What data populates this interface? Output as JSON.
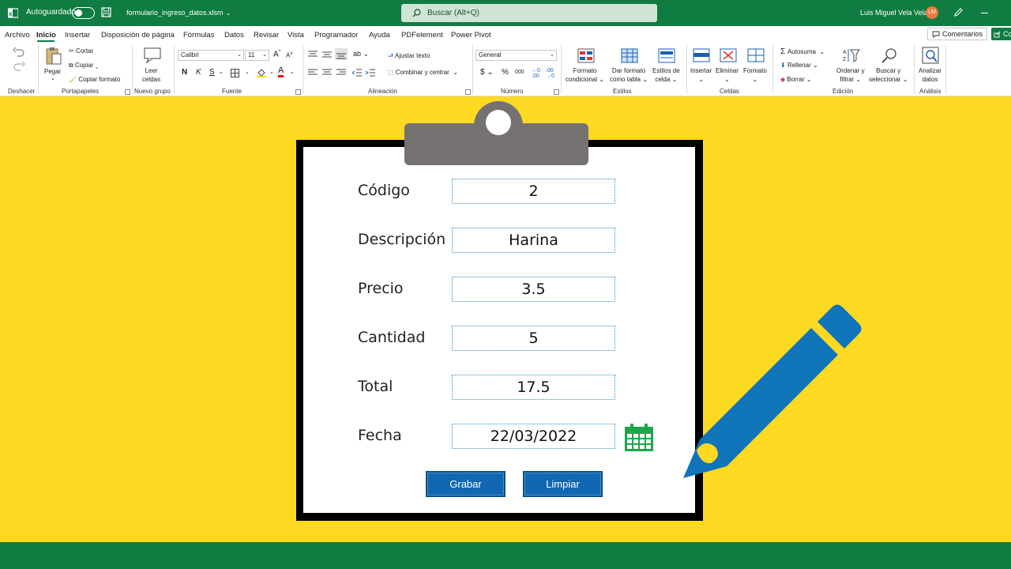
{
  "titlebar": {
    "autosave_label": "Autoguardado",
    "filename": "formulario_ingreso_datos.xlsm",
    "search_placeholder": "Buscar (Alt+Q)",
    "user_name": "Luis Miguel Vela Vela",
    "user_initials": "LM"
  },
  "menu": {
    "tabs": [
      "Archivo",
      "Inicio",
      "Insertar",
      "Disposición de página",
      "Fórmulas",
      "Datos",
      "Revisar",
      "Vista",
      "Programador",
      "Ayuda",
      "PDFelement",
      "Power Pivot"
    ],
    "active_tab": "Inicio",
    "comments_label": "Comentarios",
    "share_label": "Co"
  },
  "ribbon": {
    "undo_group": "Deshacer",
    "clipboard": {
      "paste": "Pegar",
      "cut": "Cortar",
      "copy": "Copiar",
      "format_painter": "Copiar formato",
      "group": "Portapapeles"
    },
    "new_group": {
      "read_cells_1": "Leer",
      "read_cells_2": "celdas",
      "group": "Nuevo grupo"
    },
    "font": {
      "name": "Calibri",
      "size": "11",
      "bold": "N",
      "italic": "K",
      "underline": "S",
      "grow": "A",
      "shrink": "A",
      "color_letter": "A",
      "group": "Fuente"
    },
    "alignment": {
      "wrap": "Ajustar texto",
      "merge": "Combinar y centrar",
      "group": "Alineación"
    },
    "number": {
      "format": "General",
      "currency": "$",
      "percent": "%",
      "thousands": "000",
      "group": "Número"
    },
    "styles": {
      "conditional_1": "Formato",
      "conditional_2": "condicional",
      "as_table_1": "Dar formato",
      "as_table_2": "como tabla",
      "cell_styles_1": "Estilos de",
      "cell_styles_2": "celda",
      "group": "Estilos"
    },
    "cells": {
      "insert": "Insertar",
      "delete": "Eliminar",
      "format": "Formato",
      "group": "Celdas"
    },
    "editing": {
      "autosum": "Autosuma",
      "fill": "Rellenar",
      "clear": "Borrar",
      "sort_1": "Ordenar y",
      "sort_2": "filtrar",
      "find_1": "Buscar y",
      "find_2": "seleccionar",
      "group": "Edición"
    },
    "analysis": {
      "analyze_1": "Analizar",
      "analyze_2": "datos",
      "group": "Análisis"
    }
  },
  "form": {
    "fields": [
      {
        "label": "Código",
        "value": "2"
      },
      {
        "label": "Descripción",
        "value": "Harina"
      },
      {
        "label": "Precio",
        "value": "3.5"
      },
      {
        "label": "Cantidad",
        "value": "5"
      },
      {
        "label": "Total",
        "value": "17.5"
      },
      {
        "label": "Fecha",
        "value": "22/03/2022"
      }
    ],
    "save_button": "Grabar",
    "clear_button": "Limpiar"
  },
  "colors": {
    "excel_green": "#107c41",
    "background_yellow": "#fdd921",
    "button_blue": "#1167b1",
    "pencil_blue": "#0f74b9",
    "clip_gray": "#767171",
    "calendar_green": "#1ea64b"
  }
}
